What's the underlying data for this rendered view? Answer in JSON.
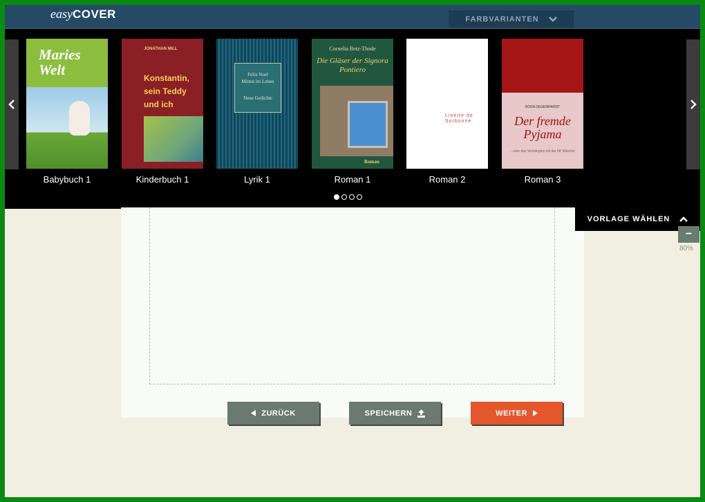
{
  "header": {
    "logo_easy": "easy",
    "logo_cover": "COVER",
    "farbvarianten_label": "FARBVARIANTEN"
  },
  "carousel": {
    "books": [
      {
        "label": "Babybuch 1",
        "cover_title": "Maries Welt"
      },
      {
        "label": "Kinderbuch 1",
        "cover_author": "JONATHAN MILL",
        "cover_title": "Konstantin, sein Teddy und ich"
      },
      {
        "label": "Lyrik 1",
        "cover_author": "Felix Noel",
        "cover_title": "Mitten im Leben",
        "cover_subtitle": "Neue Gedichte"
      },
      {
        "label": "Roman 1",
        "cover_author": "Cornelia Betz-Thode",
        "cover_title": "Die Gläser der Signora Pontiero",
        "cover_genre": "Roman"
      },
      {
        "label": "Roman 2",
        "cover_title": "Linette de Sorbonne"
      },
      {
        "label": "Roman 3",
        "cover_author": "NORA DEGENHARDT",
        "cover_title": "Der fremde Pyjama",
        "cover_subtitle": "...oder das Verhängnis mit der 68' Wäsche"
      }
    ],
    "page_count": 4,
    "active_page": 1
  },
  "vorlage_label": "VORLAGE WÄHLEN",
  "zoom": {
    "level": "80%"
  },
  "buttons": {
    "back_label": "ZURÜCK",
    "save_label": "SPEICHERN",
    "next_label": "WEITER"
  },
  "colors": {
    "header_bg": "#254a66",
    "accent": "#e4562c",
    "button_gray": "#6b7971"
  }
}
